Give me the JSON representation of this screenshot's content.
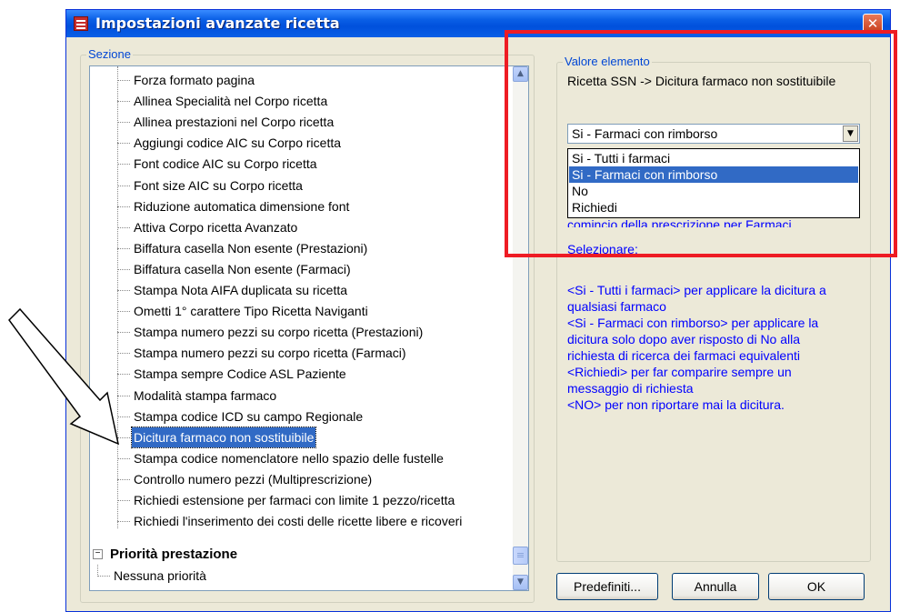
{
  "window": {
    "title": "Impostazioni avanzate ricetta",
    "close_glyph": "✕"
  },
  "section_group": {
    "label": "Sezione"
  },
  "tree": {
    "items": [
      {
        "label": "Forza formato pagina"
      },
      {
        "label": "Allinea Specialità nel Corpo ricetta"
      },
      {
        "label": "Allinea prestazioni nel Corpo ricetta"
      },
      {
        "label": "Aggiungi codice AIC su Corpo ricetta"
      },
      {
        "label": "Font codice AIC su Corpo ricetta"
      },
      {
        "label": "Font size AIC su Corpo ricetta"
      },
      {
        "label": "Riduzione automatica dimensione font"
      },
      {
        "label": "Attiva Corpo ricetta Avanzato"
      },
      {
        "label": "Biffatura casella Non esente (Prestazioni)"
      },
      {
        "label": "Biffatura casella Non esente (Farmaci)"
      },
      {
        "label": "Stampa Nota AIFA duplicata su ricetta"
      },
      {
        "label": "Ometti 1° carattere Tipo Ricetta Naviganti"
      },
      {
        "label": "Stampa numero pezzi su corpo ricetta (Prestazioni)"
      },
      {
        "label": "Stampa numero pezzi su corpo ricetta (Farmaci)"
      },
      {
        "label": "Stampa sempre Codice ASL Paziente"
      },
      {
        "label": "Modalità stampa farmaco"
      },
      {
        "label": "Stampa codice ICD su campo Regionale"
      },
      {
        "label": "Dicitura farmaco non sostituibile",
        "selected": true
      },
      {
        "label": "Stampa codice nomenclatore nello spazio delle fustelle"
      },
      {
        "label": "Controllo numero pezzi (Multiprescrizione)"
      },
      {
        "label": "Richiedi estensione per farmaci con limite 1 pezzo/ricetta"
      },
      {
        "label": "Richiedi l'inserimento dei costi delle ricette libere e ricoveri"
      }
    ],
    "parent_node": {
      "label": "Priorità prestazione",
      "expander": "−"
    },
    "child_node": {
      "label": "Nessuna priorità"
    }
  },
  "value_group": {
    "label": "Valore elemento"
  },
  "element_path": "Ricetta SSN -> Dicitura farmaco non sostituibile",
  "combo": {
    "value": "Si - Farmaci con rimborso",
    "options": [
      {
        "label": "Si - Tutti i farmaci"
      },
      {
        "label": "Si - Farmaci con rimborso",
        "selected": true
      },
      {
        "label": "No"
      },
      {
        "label": "Richiedi"
      }
    ]
  },
  "help": {
    "partial_line": "comincio della prescrizione per Farmaci.",
    "heading": "Selezionare:",
    "lines": [
      "<Si - Tutti i farmaci> per applicare la dicitura a",
      "qualsiasi farmaco",
      "<Si - Farmaci con rimborso> per applicare la",
      "dicitura solo dopo aver risposto di No alla",
      "richiesta di ricerca dei farmaci equivalenti",
      "<Richiedi> per far comparire sempre un",
      "messaggio di richiesta",
      "<NO> per non riportare mai la dicitura."
    ]
  },
  "buttons": {
    "defaults": "Predefiniti...",
    "cancel": "Annulla",
    "ok": "OK"
  },
  "colors": {
    "title_bar": "#0A5FE6",
    "selection": "#316AC5",
    "help_text": "#0000FF",
    "annotation_box": "#EE1C24"
  }
}
